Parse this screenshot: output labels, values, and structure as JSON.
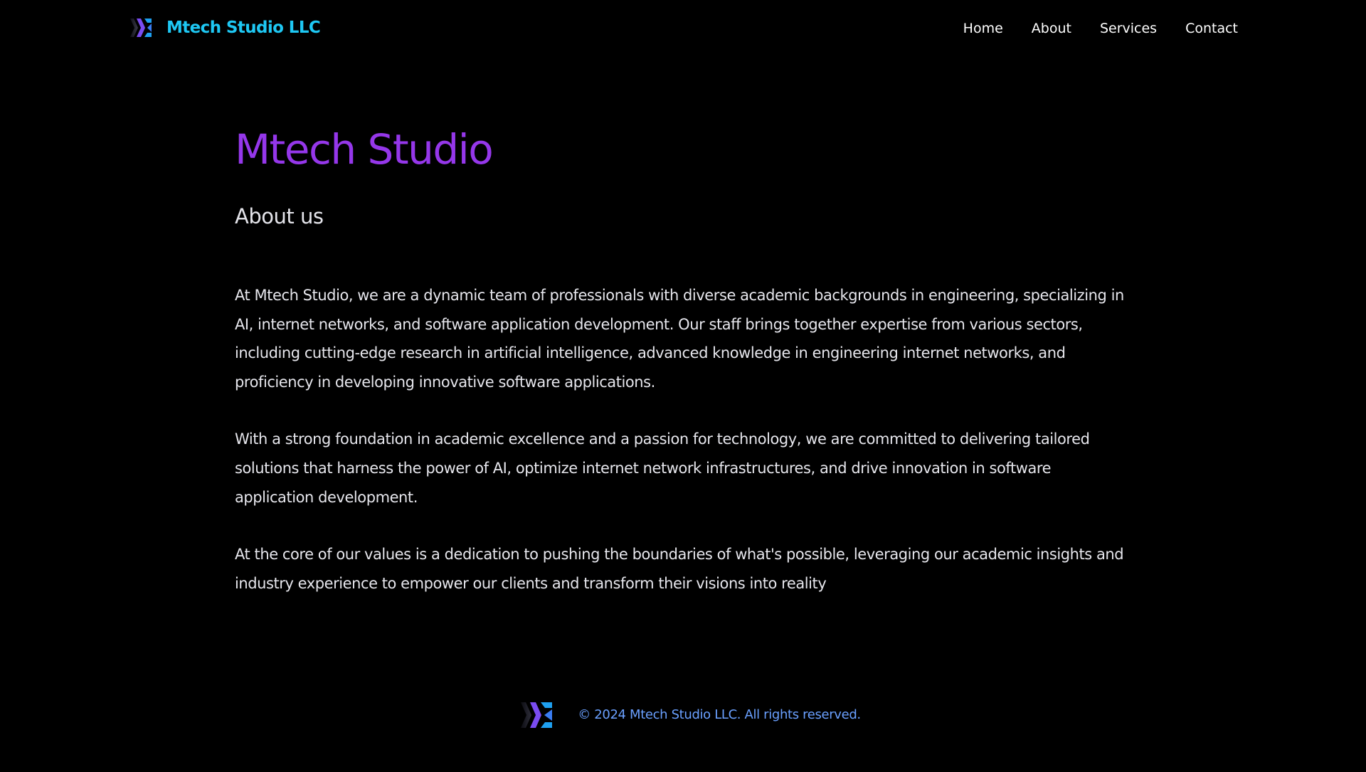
{
  "header": {
    "brand_name": "Mtech Studio LLC",
    "logo_icon": "mtech-chevron-logo",
    "nav": [
      {
        "label": "Home"
      },
      {
        "label": "About"
      },
      {
        "label": "Services"
      },
      {
        "label": "Contact"
      }
    ]
  },
  "main": {
    "title": "Mtech Studio",
    "section_title": "About us",
    "paragraphs": [
      "At Mtech Studio, we are a dynamic team of professionals with diverse academic backgrounds in engineering, specializing in AI, internet networks, and software application development. Our staff brings together expertise from various sectors, including cutting-edge research in artificial intelligence, advanced knowledge in engineering internet networks, and proficiency in developing innovative software applications.",
      "With a strong foundation in academic excellence and a passion for technology, we are committed to delivering tailored solutions that harness the power of AI, optimize internet network infrastructures, and drive innovation in software application development.",
      "At the core of our values is a dedication to pushing the boundaries of what's possible, leveraging our academic insights and industry experience to empower our clients and transform their visions into reality"
    ]
  },
  "footer": {
    "logo_icon": "mtech-chevron-logo",
    "copyright": "© 2024 Mtech Studio LLC. All rights reserved."
  },
  "colors": {
    "background": "#000000",
    "brand_cyan": "#1ec8f4",
    "title_purple": "#9537ea",
    "logo_purple": "#7a4cf0",
    "logo_blue": "#1ea0f0",
    "copyright_blue": "#6aa0ff",
    "text": "#e6e6ec"
  }
}
